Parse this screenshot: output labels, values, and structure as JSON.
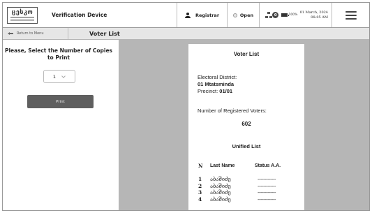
{
  "app": {
    "logo_text": "ცესკო",
    "title": "Verification Device"
  },
  "topbar": {
    "user_label": "Registrar",
    "status_label": "Open",
    "notification_count": "0",
    "battery_percent": "100%",
    "date": "01 March, 2024",
    "time": "08:05 AM"
  },
  "subheader": {
    "back_label": "Return to Menu",
    "title": "Voter List"
  },
  "print_panel": {
    "heading": "Please, Select the Number of Copies to Print",
    "copies_value": "1",
    "print_button": "Print"
  },
  "document": {
    "title": "Voter List",
    "district_label": "Electoral District:",
    "district_value": "01 Mtatsminda",
    "precinct_label": "Precinct:",
    "precinct_value": "01/01",
    "registered_label": "Number of Registered Voters:",
    "registered_count": "602",
    "list_title": "Unified List",
    "columns": [
      "N",
      "Last Name",
      "Status A.A."
    ],
    "rows": [
      {
        "n": "1",
        "last_name": "აბაშიძე",
        "status": "-------------"
      },
      {
        "n": "2",
        "last_name": "აბაშიძე",
        "status": "-------------"
      },
      {
        "n": "3",
        "last_name": "აბაშიძე",
        "status": "-------------"
      },
      {
        "n": "4",
        "last_name": "აბაშიძე",
        "status": "-------------"
      }
    ]
  },
  "colors": {
    "print_button_bg": "#5f5f5f",
    "preview_bg": "#b6b6b6",
    "subheader_bg": "#e6e6e6"
  },
  "icons": [
    "person-icon",
    "status-dot-icon",
    "network-icon",
    "battery-icon",
    "hamburger-menu-icon",
    "back-arrow-icon",
    "chevron-down-icon"
  ]
}
